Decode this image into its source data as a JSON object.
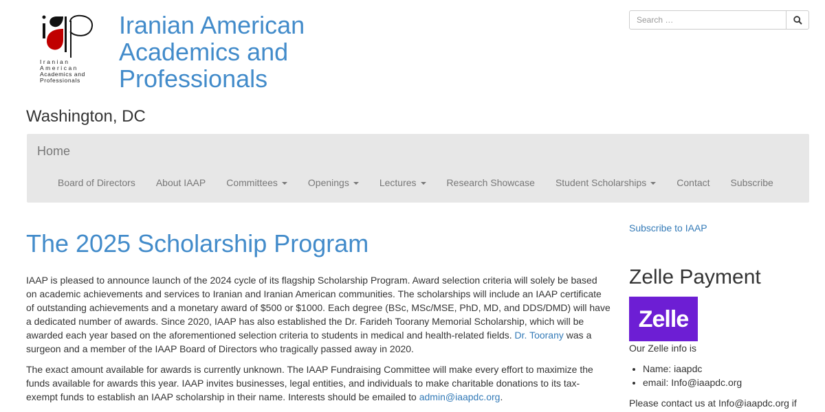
{
  "header": {
    "logo_lines": [
      "Iranian",
      "American",
      "Academics and",
      "Professionals"
    ],
    "title_lines": [
      "Iranian American",
      "Academics and",
      "Professionals"
    ],
    "tagline": "Washington, DC"
  },
  "search": {
    "placeholder": "Search …"
  },
  "navbar": {
    "brand": "Home",
    "items": [
      {
        "label": "Board of Directors",
        "dropdown": false
      },
      {
        "label": "About IAAP",
        "dropdown": false
      },
      {
        "label": "Committees",
        "dropdown": true
      },
      {
        "label": "Openings",
        "dropdown": true
      },
      {
        "label": "Lectures",
        "dropdown": true
      },
      {
        "label": "Research Showcase",
        "dropdown": false
      },
      {
        "label": "Student Scholarships",
        "dropdown": true
      },
      {
        "label": "Contact",
        "dropdown": false
      },
      {
        "label": "Subscribe",
        "dropdown": false
      }
    ]
  },
  "main": {
    "title": "The 2025 Scholarship Program",
    "p1_text": "IAAP is pleased to announce launch of the 2024 cycle of its flagship Scholarship Program. Award selection criteria will solely be based on academic achievements and services to Iranian and Iranian American communities. The scholarships will include an IAAP certificate of outstanding achievements and a monetary award of $500 or $1000. Each degree (BSc, MSc/MSE, PhD, MD, and DDS/DMD) will have a dedicated number of awards. Since 2020, IAAP has also established the Dr. Farideh Toorany Memorial Scholarship, which will be awarded each year based on the aforementioned selection criteria to students in medical and health-related fields. ",
    "p1_link": "Dr. Toorany",
    "p1_after": " was a surgeon and a member of the IAAP Board of Directors who tragically passed away in 2020.",
    "p2_text": "The exact amount available for awards is currently unknown. The IAAP Fundraising Committee will make every effort to maximize the funds available for awards this year. IAAP invites businesses, legal entities, and individuals to make charitable donations to its tax-exempt funds to establish an IAAP scholarship in their name. Interests should be emailed to ",
    "p2_link": "admin@iaapdc.org",
    "p2_after": "."
  },
  "sidebar": {
    "subscribe_link": "Subscribe to IAAP",
    "zelle_heading": "Zelle Payment",
    "zelle_logo_text": "Zelle",
    "zelle_info": "Our Zelle info is",
    "zelle_items": [
      "Name: iaapdc",
      "email: Info@iaapdc.org"
    ],
    "contact_text": "Please contact us at Info@iaapdc.org if"
  },
  "colors": {
    "link": "#337ab7",
    "heading_blue": "#428bca",
    "navbar_bg": "#e7e7e7",
    "zelle_purple": "#6d1ed4",
    "logo_red": "#c00000"
  },
  "icons": {
    "search_button": "search-icon",
    "dropdown": "caret-down-icon"
  }
}
